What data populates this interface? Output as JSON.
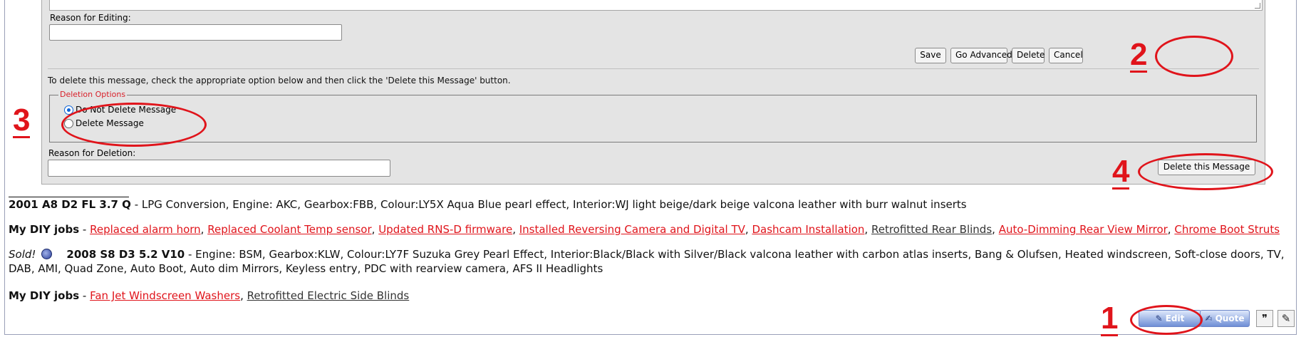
{
  "editor": {
    "reason_editing_label": "Reason for Editing:",
    "reason_editing_value": "",
    "buttons": {
      "save": "Save",
      "go_advanced": "Go Advanced",
      "delete": "Delete",
      "cancel": "Cancel"
    },
    "instructions": "To delete this message, check the appropriate option below and then click the 'Delete this Message' button.",
    "deletion_options": {
      "legend": "Deletion Options",
      "options": [
        {
          "label": "Do Not Delete Message",
          "selected": true
        },
        {
          "label": "Delete Message",
          "selected": false
        }
      ]
    },
    "reason_deletion_label": "Reason for Deletion:",
    "reason_deletion_value": "",
    "delete_message_button": "Delete this Message"
  },
  "signature": {
    "car1": {
      "title": "2001 A8 D2 FL 3.7 Q",
      "details": " - LPG Conversion, Engine: AKC, Gearbox:FBB, Colour:LY5X Aqua Blue pearl effect, Interior:WJ light beige/dark beige valcona leather with burr walnut inserts"
    },
    "diy1": {
      "label": "My DIY jobs",
      "sep": " - ",
      "links": [
        "Replaced alarm horn",
        "Replaced Coolant Temp sensor",
        "Updated RNS-D firmware",
        "Installed Reversing Camera and Digital TV",
        "Dashcam Installation",
        "Retrofitted Rear Blinds",
        "Auto-Dimming Rear View Mirror",
        "Chrome Boot Struts"
      ]
    },
    "car2": {
      "sold": "Sold!",
      "title": "2008 S8 D3 5.2 V10",
      "details": " - Engine: BSM, Gearbox:KLW, Colour:LY7F Suzuka Grey Pearl Effect, Interior:Black/Black with Silver/Black valcona leather with carbon atlas inserts, Bang & Olufsen, Heated windscreen, Soft-close doors, TV,",
      "details_line2": "DAB, AMI, Quad Zone, Auto Boot, Auto dim Mirrors, Keyless entry, PDC with rearview camera, AFS II Headlights"
    },
    "diy2": {
      "label": "My DIY jobs",
      "sep": " - ",
      "links": [
        "Fan Jet Windscreen Washers",
        "Retrofitted Electric Side Blinds"
      ]
    }
  },
  "post_controls": {
    "edit": "Edit",
    "quote": "Quote",
    "multiquote_icon": "multiquote-icon",
    "quick_reply_icon": "quick-reply-icon"
  },
  "annotations": [
    "1",
    "2",
    "3",
    "4"
  ],
  "colors": {
    "annotation": "#e0141b",
    "link": "#e0141b",
    "panel_bg": "#e4e4e4"
  }
}
